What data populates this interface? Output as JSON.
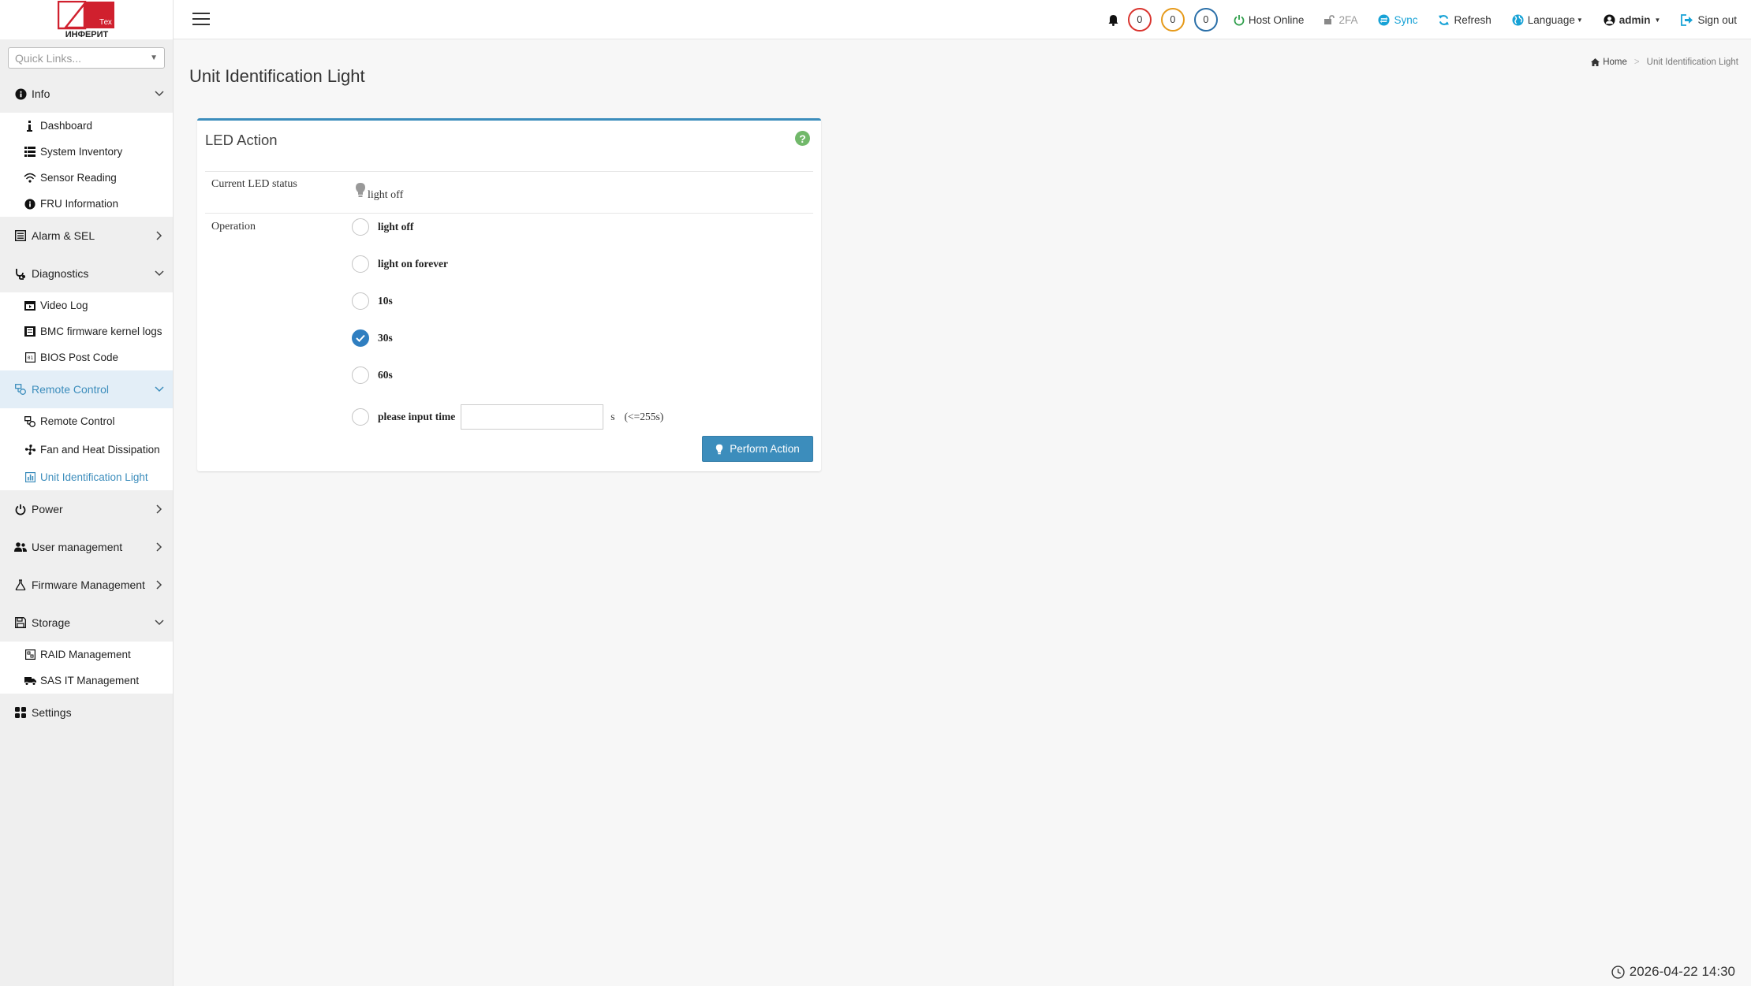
{
  "logo": {
    "text": "ИНФЕРИТ",
    "badge": "Тех",
    "brand_color": "#d0202e"
  },
  "sidebar": {
    "quick_links_placeholder": "Quick Links...",
    "sections": {
      "info": {
        "label": "Info",
        "icon": "info-circle-icon"
      },
      "dashboard": "Dashboard",
      "system_inventory": "System Inventory",
      "sensor_reading": "Sensor Reading",
      "fru_information": "FRU Information",
      "alarm_sel": {
        "label": "Alarm & SEL",
        "icon": "list-icon"
      },
      "diagnostics": {
        "label": "Diagnostics",
        "icon": "stethoscope-icon"
      },
      "video_log": "Video Log",
      "bmc_kernel_logs": "BMC firmware kernel logs",
      "bios_post_code": "BIOS Post Code",
      "remote_control": {
        "label": "Remote Control",
        "icon": "remote-icon"
      },
      "remote_control_item": "Remote Control",
      "fan_heat": "Fan and Heat Dissipation",
      "uid_light": "Unit Identification Light",
      "power": {
        "label": "Power",
        "icon": "power-icon"
      },
      "user_management": {
        "label": "User management",
        "icon": "users-icon"
      },
      "firmware_management": {
        "label": "Firmware Management",
        "icon": "flask-icon"
      },
      "storage": {
        "label": "Storage",
        "icon": "save-icon"
      },
      "raid_management": "RAID Management",
      "sas_it_management": "SAS IT Management",
      "settings": {
        "label": "Settings",
        "icon": "grid-icon"
      }
    }
  },
  "topbar": {
    "alert_counts": {
      "critical": "0",
      "warning": "0",
      "info": "0"
    },
    "alert_colors": {
      "critical": "#d9322c",
      "warning": "#e69a1a",
      "info": "#2a6fa8"
    },
    "host_status": "Host Online",
    "twofa": "2FA",
    "sync": "Sync",
    "refresh": "Refresh",
    "language": "Language",
    "user": "admin",
    "sign_out": "Sign out"
  },
  "page": {
    "title": "Unit Identification Light",
    "breadcrumb": {
      "home": "Home",
      "current": "Unit Identification Light"
    }
  },
  "panel": {
    "title": "LED Action",
    "help": "?",
    "current_status_label": "Current LED status",
    "current_status_value": "light off",
    "operation_label": "Operation",
    "options": {
      "light_off": "light off",
      "light_on_forever": "light on forever",
      "s10": "10s",
      "s30": "30s",
      "s60": "60s",
      "custom": "please input time"
    },
    "selected": "30s",
    "custom_time_value": "",
    "unit": "s",
    "limit": "(<=255s)",
    "perform_button": "Perform Action"
  },
  "footer": {
    "datetime": "2026-04-22 14:30"
  },
  "accent_color": "#3c8dbc"
}
